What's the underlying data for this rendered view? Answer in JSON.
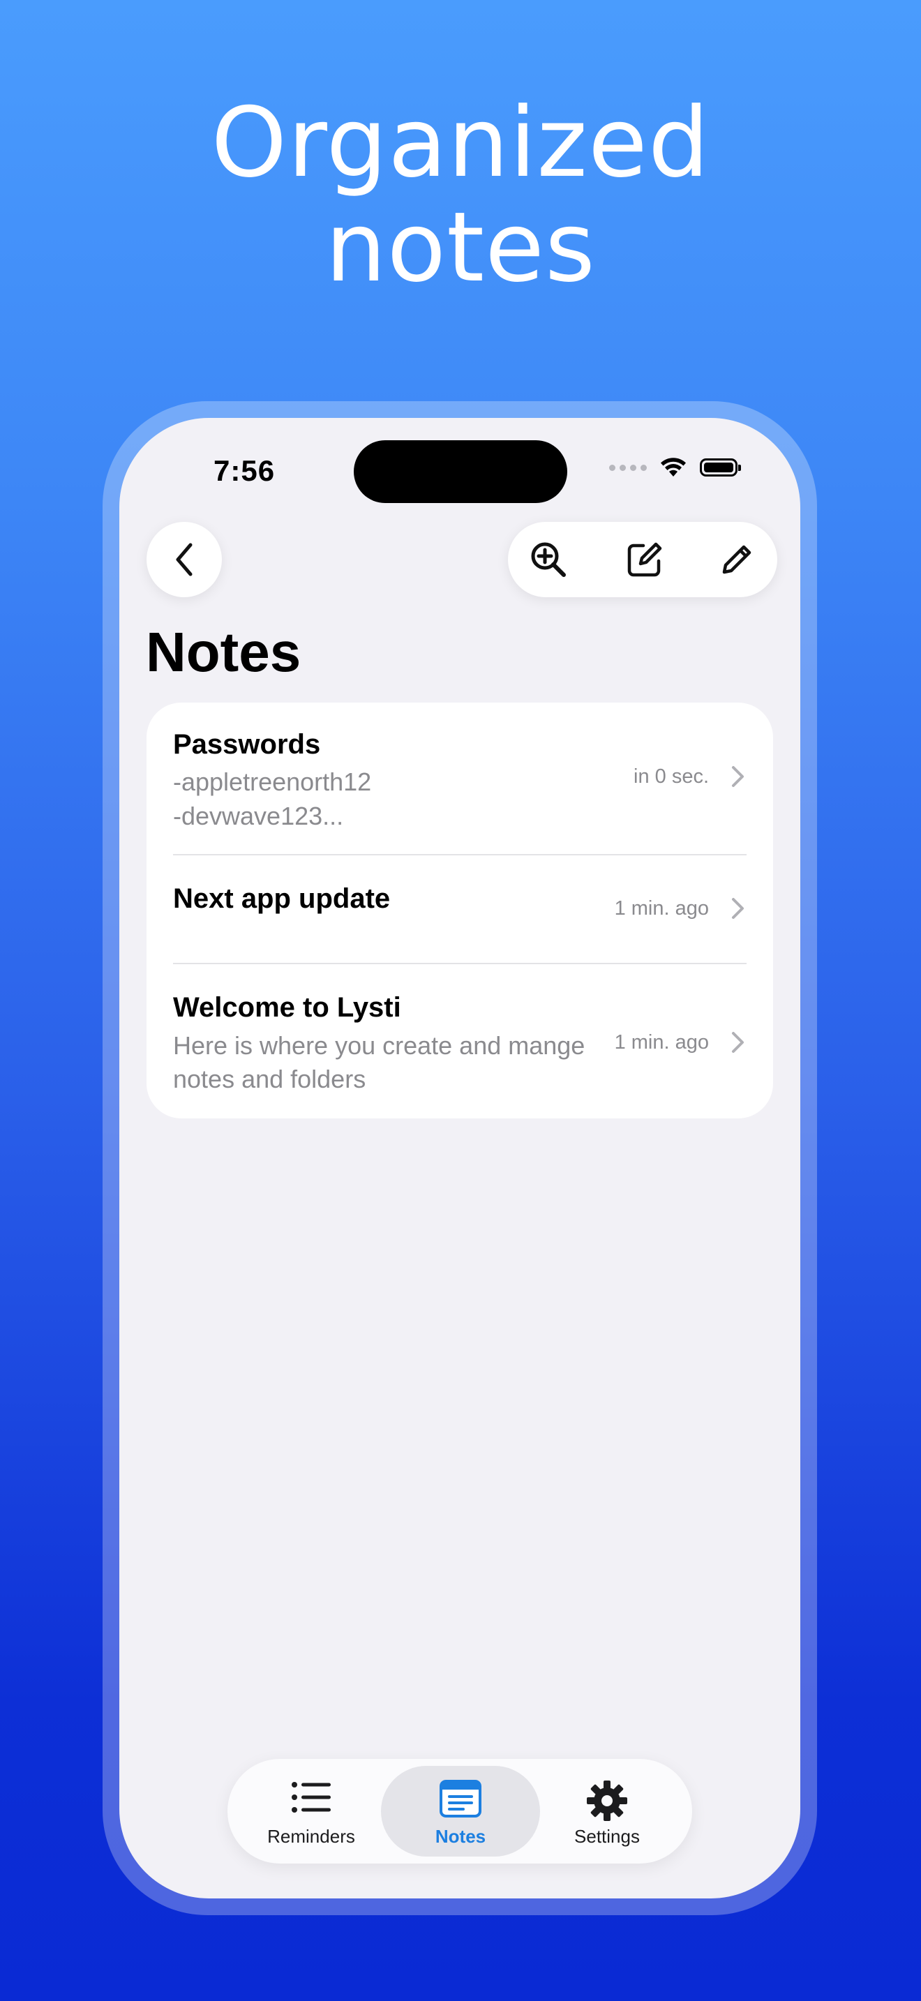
{
  "headline": {
    "line1": "Organized",
    "line2": "notes"
  },
  "status_bar": {
    "time": "7:56"
  },
  "toolbar": {
    "back_icon": "chevron-left-icon",
    "zoom_icon": "zoom-in-icon",
    "compose_icon": "compose-icon",
    "pencil_icon": "pencil-icon"
  },
  "page": {
    "title": "Notes"
  },
  "notes": [
    {
      "title": "Passwords",
      "preview_line1": "-appletreenorth12",
      "preview_line2": "-devwave123...",
      "time": "in 0 sec."
    },
    {
      "title": "Next app update",
      "preview_line1": "",
      "preview_line2": "",
      "time": "1 min. ago"
    },
    {
      "title": "Welcome to Lysti",
      "preview_line1": "Here is where you create and mange",
      "preview_line2": "notes and folders",
      "time": "1 min. ago"
    }
  ],
  "tabbar": {
    "tabs": [
      {
        "label": "Reminders",
        "icon": "list-icon",
        "active": false
      },
      {
        "label": "Notes",
        "icon": "notes-icon",
        "active": true
      },
      {
        "label": "Settings",
        "icon": "gear-icon",
        "active": false
      }
    ]
  },
  "colors": {
    "accent": "#1c7fe0",
    "background_top": "#4a9cfd",
    "background_bottom": "#0a2ad4"
  }
}
